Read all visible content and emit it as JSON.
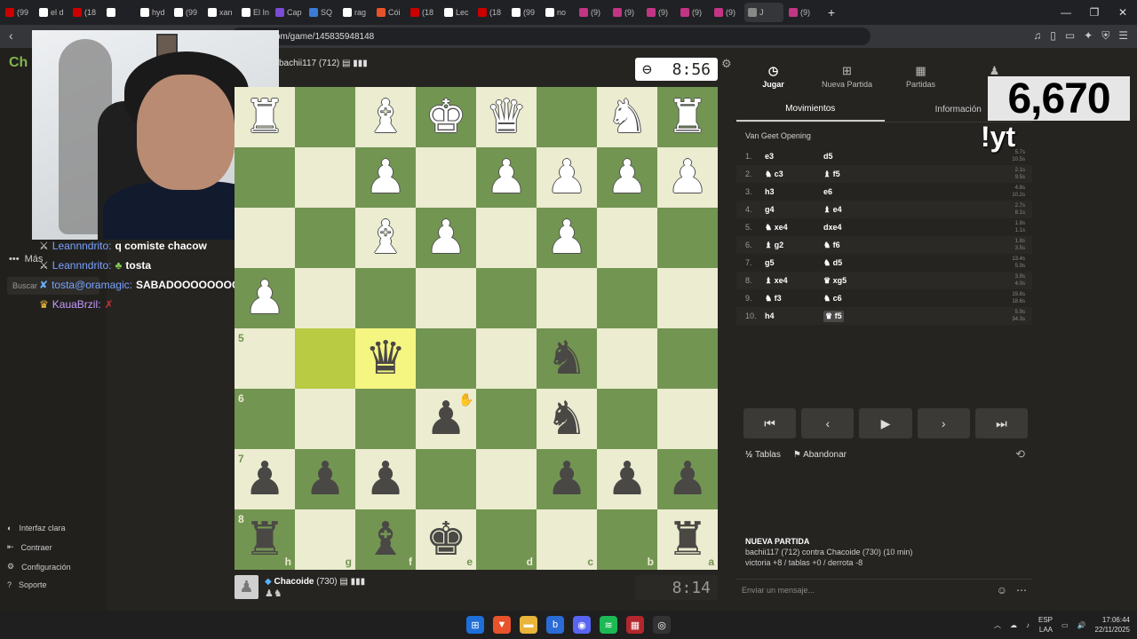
{
  "browser": {
    "tabs": [
      "(99",
      "el d",
      "(18",
      "",
      "hyd",
      "(99",
      "xan",
      "El In",
      "Cap",
      "SQ",
      "rag",
      "Cói",
      "(18",
      "Lec",
      "(18",
      "(99",
      "no",
      "(9)",
      "(9)",
      "(9)",
      "(9)",
      "(9)",
      "J",
      "(9)"
    ],
    "url": "om/game/145835948148"
  },
  "sidebar": {
    "logo": "Ch",
    "more_label": "Más",
    "search_placeholder": "Buscar",
    "bottom_items": [
      {
        "icon": "sun-icon",
        "label": "Interfaz clara"
      },
      {
        "icon": "collapse-icon",
        "label": "Contraer"
      },
      {
        "icon": "gear-icon",
        "label": "Configuración"
      },
      {
        "icon": "help-icon",
        "label": "Soporte"
      }
    ]
  },
  "chat_overlay": [
    {
      "user": "Leannndrito:",
      "message": "q comiste chacow"
    },
    {
      "user": "Leannndrito:",
      "message": "tosta"
    },
    {
      "user": "tosta@oramagic:",
      "message": "SABADOOOOOOOOOOO"
    },
    {
      "user": "KauaBrzil:",
      "message": ""
    }
  ],
  "top_player": {
    "name": "bachii117",
    "rating": "(712)",
    "clock": "8:56"
  },
  "bottom_player": {
    "name": "Chacoide",
    "rating": "(730)",
    "clock": "8:14"
  },
  "board": {
    "orientation": "black",
    "highlight": [
      "g5",
      "f5"
    ],
    "rank_labels": [
      "5",
      "6",
      "7",
      "8"
    ],
    "file_labels": [
      "h",
      "g",
      "f",
      "e",
      "d",
      "c",
      "b",
      "a"
    ],
    "pieces": {
      "a1": "R",
      "b1": "N",
      "d1": "Q",
      "e1": "K",
      "f1": "B",
      "h1": "R",
      "a2": "P",
      "b2": "P",
      "c2": "P",
      "d2": "P",
      "f2": "P",
      "c3": "P",
      "f3": "B",
      "e3": "P",
      "h4": "P",
      "c5": "n",
      "f5": "q",
      "c6": "n",
      "e6": "p",
      "a7": "p",
      "b7": "p",
      "c7": "p",
      "f7": "p",
      "g7": "p",
      "h7": "p",
      "a8": "r",
      "e8": "k",
      "f8": "b",
      "h8": "r"
    }
  },
  "panel": {
    "tabs": [
      {
        "icon": "clock-icon",
        "label": "Jugar"
      },
      {
        "icon": "plus-icon",
        "label": "Nueva Partida"
      },
      {
        "icon": "board-icon",
        "label": "Partidas"
      },
      {
        "icon": "players-icon",
        "label": "Ju"
      }
    ],
    "subtabs": [
      "Movimientos",
      "Información"
    ],
    "opening": "Van Geet Opening",
    "moves": [
      {
        "n": "1.",
        "w": "e3",
        "b": "d5",
        "tw": "5.7s",
        "tb": "10.5s"
      },
      {
        "n": "2.",
        "w": "♞ c3",
        "b": "♝ f5",
        "tw": "2.1s",
        "tb": "9.5s"
      },
      {
        "n": "3.",
        "w": "h3",
        "b": "e6",
        "tw": "4.8s",
        "tb": "10.2s"
      },
      {
        "n": "4.",
        "w": "g4",
        "b": "♝ e4",
        "tw": "2.7s",
        "tb": "8.1s"
      },
      {
        "n": "5.",
        "w": "♞ xe4",
        "b": "dxe4",
        "tw": "1.8s",
        "tb": "1.1s"
      },
      {
        "n": "6.",
        "w": "♝ g2",
        "b": "♞ f6",
        "tw": "1.8s",
        "tb": "3.5s"
      },
      {
        "n": "7.",
        "w": "g5",
        "b": "♞ d5",
        "tw": "13.4s",
        "tb": "5.9s"
      },
      {
        "n": "8.",
        "w": "♝ xe4",
        "b": "♛ xg5",
        "tw": "3.9s",
        "tb": "4.0s"
      },
      {
        "n": "9.",
        "w": "♞ f3",
        "b": "♞ c6",
        "tw": "19.8s",
        "tb": "18.6s"
      },
      {
        "n": "10.",
        "w": "h4",
        "b": "♛ f5",
        "tw": "5.9s",
        "tb": "34.3s"
      }
    ],
    "draw_label": "Tablas",
    "resign_label": "Abandonar",
    "new_game_title": "NUEVA PARTIDA",
    "new_game_line1": "bachii117 (712) contra Chacoide (730) (10 min)",
    "new_game_line2": "victoria +8 / tablas +0 / derrota -8",
    "chat_placeholder": "Enviar un mensaje..."
  },
  "overlay": {
    "counter": "6,670",
    "command": "!yt"
  },
  "taskbar": {
    "lang": "ESP",
    "lang2": "LAA",
    "time": "17:06:44",
    "date": "22/11/2025"
  },
  "colors": {
    "board_light": "#ebecd0",
    "board_dark": "#739552",
    "highlight_light": "#f5f682",
    "highlight_dark": "#b9ca43",
    "accent": "#81b64c"
  }
}
